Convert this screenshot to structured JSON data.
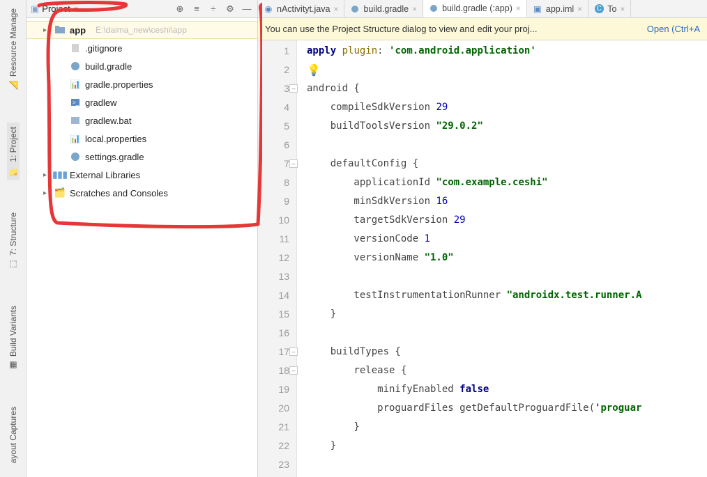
{
  "left_tools": {
    "resource_manager": "Resource Manage",
    "project": "1: Project",
    "structure": "7: Structure",
    "build_variants": "Build Variants",
    "layout_captures": "ayout Captures"
  },
  "project_header": {
    "mode_label": "Project"
  },
  "tree": {
    "root": {
      "label": "app",
      "hint": "E:\\daima_new\\ceshi\\app"
    },
    "items": [
      {
        "label": ".gitignore",
        "icon": "file"
      },
      {
        "label": "build.gradle",
        "icon": "gradle"
      },
      {
        "label": "gradle.properties",
        "icon": "props"
      },
      {
        "label": "gradlew",
        "icon": "shell"
      },
      {
        "label": "gradlew.bat",
        "icon": "bat"
      },
      {
        "label": "local.properties",
        "icon": "props"
      },
      {
        "label": "settings.gradle",
        "icon": "gradle"
      }
    ],
    "extra": [
      {
        "label": "External Libraries",
        "icon": "libs"
      },
      {
        "label": "Scratches and Consoles",
        "icon": "scratch"
      }
    ]
  },
  "tabs": [
    {
      "label": "nActivityt.java",
      "icon": "java"
    },
    {
      "label": "build.gradle",
      "icon": "gradle"
    },
    {
      "label": "build.gradle (:app)",
      "icon": "gradle",
      "active": true
    },
    {
      "label": "app.iml",
      "icon": "iml"
    },
    {
      "label": "To",
      "icon": "cfile"
    }
  ],
  "banner": {
    "msg": "You can use the Project Structure dialog to view and edit your proj...",
    "action": "Open (Ctrl+A"
  },
  "code": {
    "lines": [
      {
        "n": 1,
        "seg": [
          [
            "kw",
            "apply"
          ],
          [
            "pl",
            " "
          ],
          [
            "prop",
            "plugin"
          ],
          [
            "pl",
            ": "
          ],
          [
            "str",
            "'com.android.application'"
          ]
        ]
      },
      {
        "n": 2,
        "seg": [],
        "bulb": true
      },
      {
        "n": 3,
        "seg": [
          [
            "pl",
            "android {"
          ]
        ],
        "fold": true
      },
      {
        "n": 4,
        "seg": [
          [
            "pl",
            "    compileSdkVersion "
          ],
          [
            "num",
            "29"
          ]
        ]
      },
      {
        "n": 5,
        "seg": [
          [
            "pl",
            "    buildToolsVersion "
          ],
          [
            "str",
            "\"29.0.2\""
          ]
        ]
      },
      {
        "n": 6,
        "seg": []
      },
      {
        "n": 7,
        "seg": [
          [
            "pl",
            "    defaultConfig {"
          ]
        ],
        "fold": true
      },
      {
        "n": 8,
        "seg": [
          [
            "pl",
            "        applicationId "
          ],
          [
            "str",
            "\"com.example.ceshi\""
          ]
        ]
      },
      {
        "n": 9,
        "seg": [
          [
            "pl",
            "        minSdkVersion "
          ],
          [
            "num",
            "16"
          ]
        ]
      },
      {
        "n": 10,
        "seg": [
          [
            "pl",
            "        targetSdkVersion "
          ],
          [
            "num",
            "29"
          ]
        ]
      },
      {
        "n": 11,
        "seg": [
          [
            "pl",
            "        versionCode "
          ],
          [
            "num",
            "1"
          ]
        ]
      },
      {
        "n": 12,
        "seg": [
          [
            "pl",
            "        versionName "
          ],
          [
            "str",
            "\"1.0\""
          ]
        ]
      },
      {
        "n": 13,
        "seg": []
      },
      {
        "n": 14,
        "seg": [
          [
            "pl",
            "        testInstrumentationRunner "
          ],
          [
            "str",
            "\"androidx.test.runner.A"
          ]
        ]
      },
      {
        "n": 15,
        "seg": [
          [
            "pl",
            "    }"
          ]
        ]
      },
      {
        "n": 16,
        "seg": []
      },
      {
        "n": 17,
        "seg": [
          [
            "pl",
            "    buildTypes {"
          ]
        ],
        "fold": true
      },
      {
        "n": 18,
        "seg": [
          [
            "pl",
            "        release {"
          ]
        ],
        "fold": true
      },
      {
        "n": 19,
        "seg": [
          [
            "pl",
            "            minifyEnabled "
          ],
          [
            "kw",
            "false"
          ]
        ]
      },
      {
        "n": 20,
        "seg": [
          [
            "pl",
            "            proguardFiles getDefaultProguardFile("
          ],
          [
            "str",
            "'proguar"
          ]
        ]
      },
      {
        "n": 21,
        "seg": [
          [
            "pl",
            "        }"
          ]
        ]
      },
      {
        "n": 22,
        "seg": [
          [
            "pl",
            "    }"
          ]
        ]
      },
      {
        "n": 23,
        "seg": []
      }
    ]
  }
}
